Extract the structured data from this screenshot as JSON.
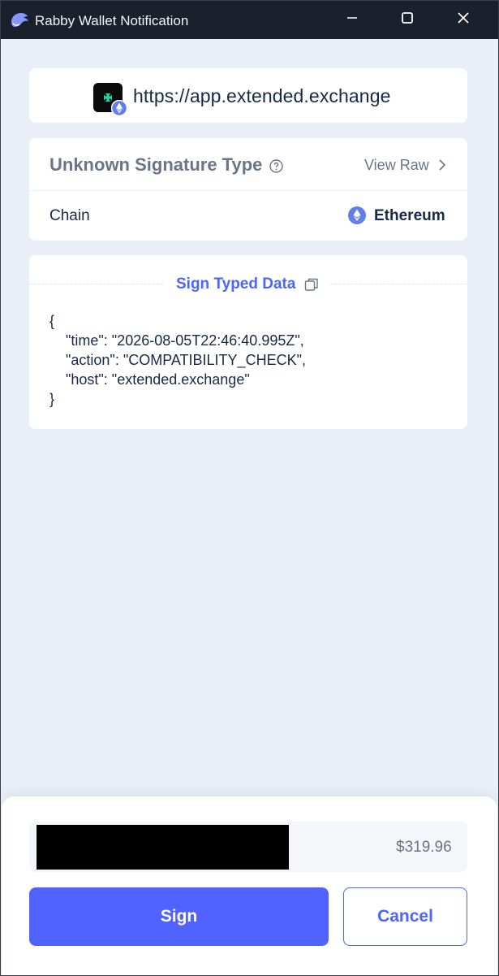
{
  "window": {
    "title": "Rabby Wallet Notification",
    "icons": [
      "rabby-logo-icon",
      "minimize-icon",
      "maximize-icon",
      "close-icon"
    ]
  },
  "origin": {
    "url": "https://app.extended.exchange",
    "site_icon": "extended-exchange-logo-icon",
    "chain_badge_icon": "ethereum-icon"
  },
  "signature": {
    "type_title": "Unknown Signature Type",
    "help_icon": "question-circle-icon",
    "view_raw": "View Raw",
    "chain_label": "Chain",
    "chain_value": "Ethereum"
  },
  "typed_data": {
    "title": "Sign Typed Data",
    "copy_icon": "copy-icon",
    "lines": [
      "{",
      "    \"time\": \"2026-08-05T22:46:40.995Z\",",
      "    \"action\": \"COMPATIBILITY_CHECK\",",
      "    \"host\": \"extended.exchange\"",
      "}"
    ]
  },
  "footer": {
    "balance": "$319.96",
    "sign_label": "Sign",
    "cancel_label": "Cancel"
  },
  "colors": {
    "accent": "#4c65ff",
    "titlebar": "#1a202c",
    "background": "#eaeef6"
  }
}
